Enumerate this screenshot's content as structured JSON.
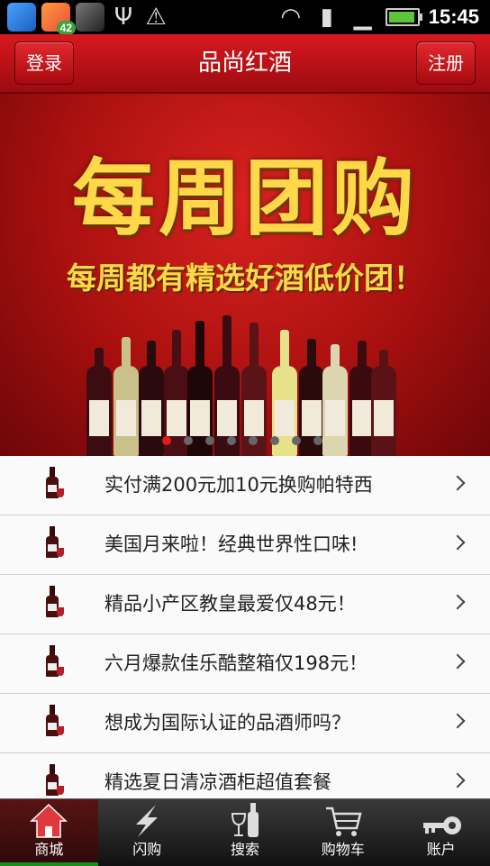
{
  "status_bar": {
    "badge": "42",
    "time": "15:45"
  },
  "header": {
    "login": "登录",
    "title": "品尚红酒",
    "register": "注册"
  },
  "banner": {
    "title": "每周团购",
    "subtitle": "每周都有精选好酒低价团！",
    "active_slide": 1,
    "slide_count": 8
  },
  "list": [
    {
      "text": "实付满200元加10元换购帕特西"
    },
    {
      "text": "美国月来啦！经典世界性口味!"
    },
    {
      "text": "精品小产区教皇最爱仅48元！"
    },
    {
      "text": "六月爆款佳乐酷整箱仅198元！"
    },
    {
      "text": "想成为国际认证的品酒师吗？"
    },
    {
      "text": "精选夏日清凉酒柜超值套餐"
    }
  ],
  "tabs": [
    {
      "label": "商城",
      "icon": "home-icon",
      "active": true
    },
    {
      "label": "闪购",
      "icon": "lightning-icon",
      "active": false
    },
    {
      "label": "搜索",
      "icon": "wine-glass-bottle-icon",
      "active": false
    },
    {
      "label": "购物车",
      "icon": "cart-icon",
      "active": false
    },
    {
      "label": "账户",
      "icon": "key-icon",
      "active": false
    }
  ],
  "colors": {
    "brand_red": "#d8191f",
    "banner_gold": "#ffd84a",
    "active_tab_indicator": "#1a8d1a"
  }
}
